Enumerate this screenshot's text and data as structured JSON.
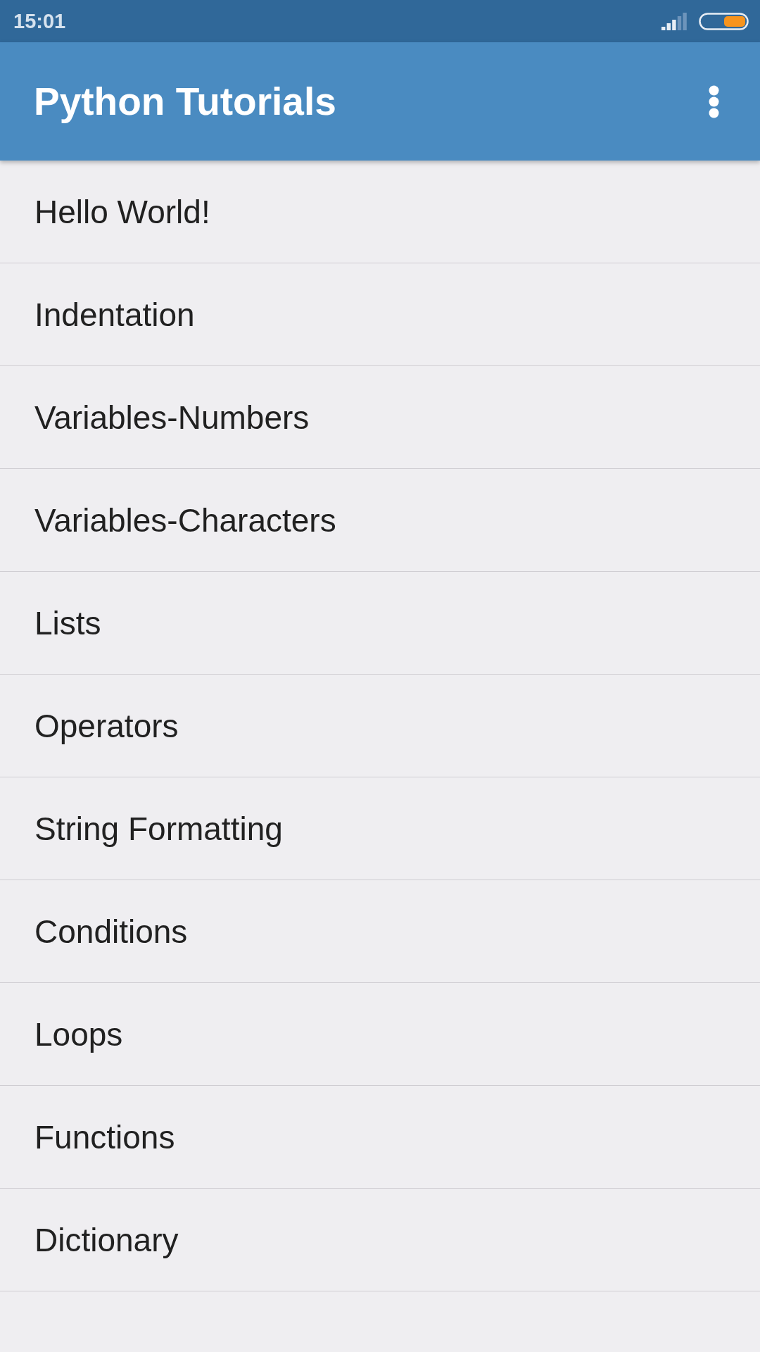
{
  "status_bar": {
    "time": "15:01"
  },
  "app_bar": {
    "title": "Python Tutorials"
  },
  "list": {
    "items": [
      {
        "label": "Hello World!"
      },
      {
        "label": "Indentation"
      },
      {
        "label": "Variables-Numbers"
      },
      {
        "label": "Variables-Characters"
      },
      {
        "label": "Lists"
      },
      {
        "label": "Operators"
      },
      {
        "label": "String Formatting"
      },
      {
        "label": "Conditions"
      },
      {
        "label": "Loops"
      },
      {
        "label": "Functions"
      },
      {
        "label": "Dictionary"
      }
    ]
  }
}
